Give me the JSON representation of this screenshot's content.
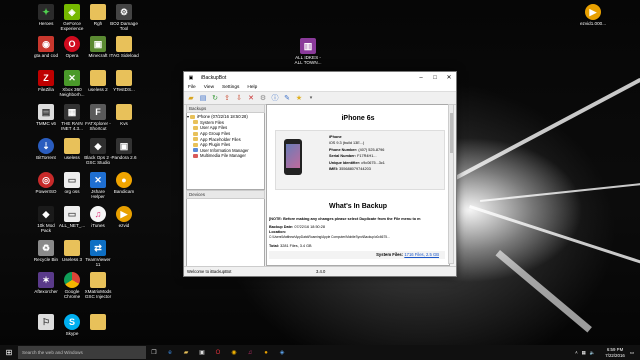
{
  "window": {
    "title": "iBackupBot",
    "menu": [
      "File",
      "View",
      "Settings",
      "Help"
    ],
    "left": {
      "backup_header": "Backups",
      "devices_header": "Devices",
      "tree": [
        {
          "label": "iPhone (07/22/16 18:50:28)"
        },
        {
          "label": "System Files"
        },
        {
          "label": "User App Files"
        },
        {
          "label": "App Group Files"
        },
        {
          "label": "App Placeholder Files"
        },
        {
          "label": "App Plugin Files"
        },
        {
          "label": "User Information Manager"
        },
        {
          "label": "Multimedia File Manager"
        }
      ]
    },
    "content": {
      "device_title": "iPhone 6s",
      "device_name": "iPhone",
      "ios": "iOS 9.3 (build 13E...)",
      "phone_label": "Phone Number:",
      "phone_value": "(407) 525-8796",
      "serial_label": "Serial Number:",
      "serial_value": "F17R4H1...",
      "udid_label": "Unique Identifier:",
      "udid_value": "c9c0675...3c1",
      "imei_label": "IMEI:",
      "imei_value": "355688079744203",
      "section_title": "What's In Backup",
      "note": "[NOTE: Before making any changes please select Duplicate from the File menu to m",
      "backup_date_label": "Backup Date:",
      "backup_date_value": "07/22/16 18:50:28",
      "location_label": "Location:",
      "location_value": "C:\\Users\\Matthew\\AppData\\Roaming\\Apple Computer\\MobileSync\\Backup\\c0c6675...",
      "total_label": "Total:",
      "total_value": "3281 Files, 3.4 GB",
      "system_label": "System Files:",
      "system_value": "1716 Files, 2.5 GB"
    },
    "status_left": "Welcome to iBackupBot",
    "status_center": "3.4.0"
  },
  "desktop_icons": [
    {
      "label": "Heroes"
    },
    {
      "label": "GeForce\nExperience"
    },
    {
      "label": "Rgh"
    },
    {
      "label": "BO2 Damage\nTool"
    },
    {
      "label": "gta and cod"
    },
    {
      "label": "Opera"
    },
    {
      "label": "Minecraft"
    },
    {
      "label": "ITAG Sideload"
    },
    {
      "label": "FileZilla"
    },
    {
      "label": "Xbox 360\nNeighborh..."
    },
    {
      "label": "useless 2"
    },
    {
      "label": "YTestDS..."
    },
    {
      "label": "TMMC v6"
    },
    {
      "label": "THE RAIN\nINET 4.3..."
    },
    {
      "label": "FATXplorer -\nShortcut"
    },
    {
      "label": "Kvs"
    },
    {
      "label": "BitTorrent"
    },
    {
      "label": "useless"
    },
    {
      "label": "Black Ops 2 -\nGSC Studio"
    },
    {
      "label": "Pandora 2.6"
    },
    {
      "label": "PowerISO"
    },
    {
      "label": "org oss"
    },
    {
      "label": "Jshare\nHelper"
    },
    {
      "label": "Bandicam"
    },
    {
      "label": "10k Mod\nPack"
    },
    {
      "label": "ALL_NET_..."
    },
    {
      "label": "iTunes"
    },
    {
      "label": "ezvid"
    },
    {
      "label": "Recycle Bin"
    },
    {
      "label": "Useless 3"
    },
    {
      "label": "TeamViewer\n11"
    },
    {
      "label": "Aftexorcher"
    },
    {
      "label": "Google\nChrome"
    },
    {
      "label": "XMatrixMods\nGSC Injector"
    },
    {
      "label": "Skype"
    },
    {
      "label": "ALL IDKES -\nALL TOWN..."
    },
    {
      "label": "ezvid1.000..."
    }
  ],
  "taskbar": {
    "search_placeholder": "Search the web and Windows",
    "time": "6:59 PM",
    "date": "7/22/2016"
  }
}
